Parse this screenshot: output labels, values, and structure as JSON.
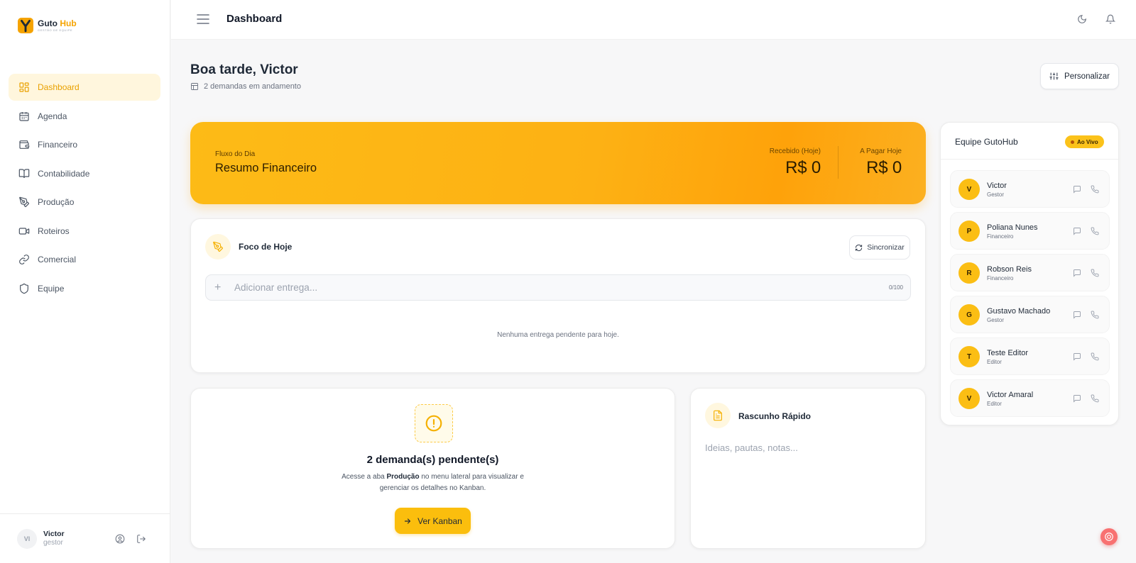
{
  "brand": {
    "name_part1": "Guto",
    "name_part2": "Hub",
    "tagline": "GESTÃO DE EQUIPE",
    "accent_color": "#f5a300"
  },
  "sidebar": {
    "items": [
      {
        "label": "Dashboard",
        "icon": "dashboard-icon",
        "active": true
      },
      {
        "label": "Agenda",
        "icon": "calendar-icon"
      },
      {
        "label": "Financeiro",
        "icon": "wallet-icon"
      },
      {
        "label": "Contabilidade",
        "icon": "book-icon"
      },
      {
        "label": "Produção",
        "icon": "pen-tool-icon"
      },
      {
        "label": "Roteiros",
        "icon": "video-icon"
      },
      {
        "label": "Comercial",
        "icon": "link-icon"
      },
      {
        "label": "Equipe",
        "icon": "shield-icon"
      }
    ],
    "user": {
      "initials": "VI",
      "name": "Victor",
      "role": "gestor"
    }
  },
  "topbar": {
    "title": "Dashboard"
  },
  "greeting": {
    "title": "Boa tarde, Victor",
    "subtitle": "2 demandas em andamento",
    "customize_label": "Personalizar"
  },
  "financial": {
    "kicker": "Fluxo do Dia",
    "title": "Resumo Financeiro",
    "received_label": "Recebido (Hoje)",
    "received_value": "R$ 0",
    "payable_label": "A Pagar Hoje",
    "payable_value": "R$ 0"
  },
  "focus": {
    "title": "Foco de Hoje",
    "sync_label": "Sincronizar",
    "input_placeholder": "Adicionar entrega...",
    "input_value": "",
    "counter": "0/100",
    "empty_message": "Nenhuma entrega pendente para hoje."
  },
  "pending": {
    "title": "2 demanda(s) pendente(s)",
    "text_before": "Acesse a aba ",
    "text_bold": "Produção",
    "text_after": " no menu lateral para visualizar e gerenciar os detalhes no Kanban.",
    "button_label": "Ver Kanban"
  },
  "draft": {
    "title": "Rascunho Rápido",
    "placeholder": "Ideias, pautas, notas...",
    "value": ""
  },
  "team": {
    "title": "Equipe GutoHub",
    "live_label": "Ao Vivo",
    "members": [
      {
        "initial": "V",
        "name": "Victor",
        "role": "Gestor"
      },
      {
        "initial": "P",
        "name": "Poliana Nunes",
        "role": "Financeiro"
      },
      {
        "initial": "R",
        "name": "Robson Reis",
        "role": "Financeiro"
      },
      {
        "initial": "G",
        "name": "Gustavo Machado",
        "role": "Gestor"
      },
      {
        "initial": "T",
        "name": "Teste Editor",
        "role": "Editor"
      },
      {
        "initial": "V",
        "name": "Victor Amaral",
        "role": "Editor"
      }
    ]
  }
}
